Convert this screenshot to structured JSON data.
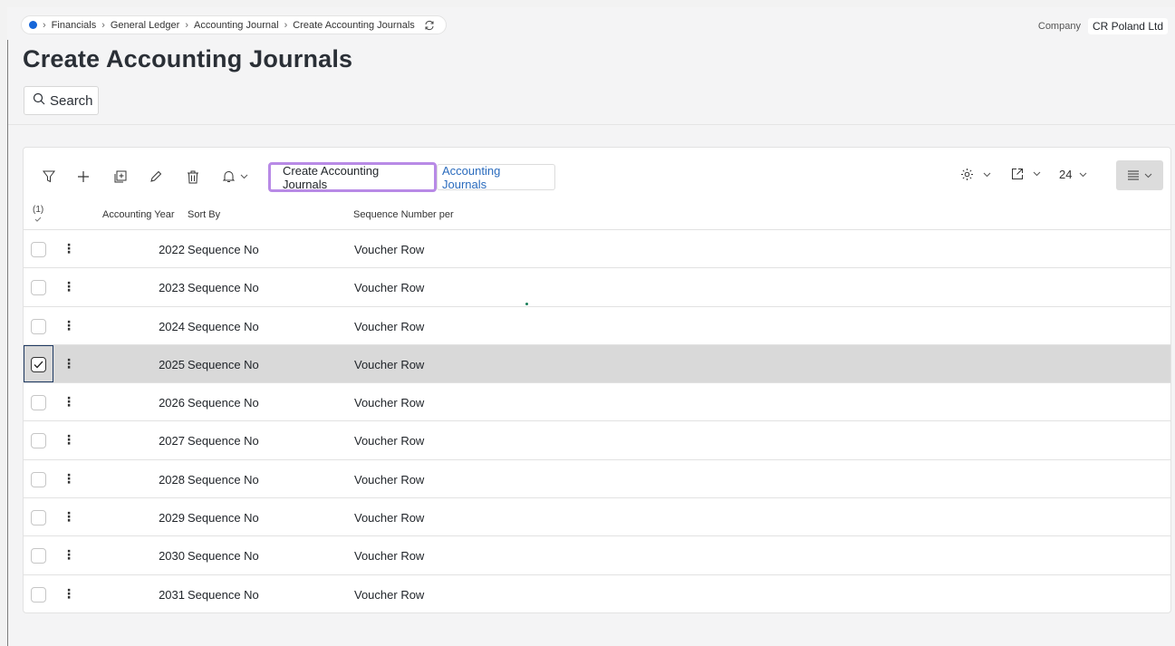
{
  "breadcrumb": {
    "items": [
      "Financials",
      "General Ledger",
      "Accounting Journal",
      "Create Accounting Journals"
    ]
  },
  "company": {
    "label": "Company",
    "value": "CR Poland Ltd"
  },
  "page": {
    "title": "Create Accounting Journals"
  },
  "search": {
    "label": "Search"
  },
  "toolbar": {
    "create_label": "Create Accounting Journals",
    "journals_label": "Accounting Journals",
    "page_size": "24",
    "icons": [
      "filter-icon",
      "add-icon",
      "duplicate-icon",
      "edit-icon",
      "delete-icon",
      "bell-icon",
      "settings-icon",
      "export-icon",
      "list-view-icon"
    ]
  },
  "grid": {
    "selected_count": "(1)",
    "columns": {
      "year": "Accounting Year",
      "sort": "Sort By",
      "seq": "Sequence Number per"
    },
    "rows": [
      {
        "year": "2022",
        "sort": "Sequence No",
        "seq": "Voucher Row",
        "selected": false
      },
      {
        "year": "2023",
        "sort": "Sequence No",
        "seq": "Voucher Row",
        "selected": false
      },
      {
        "year": "2024",
        "sort": "Sequence No",
        "seq": "Voucher Row",
        "selected": false
      },
      {
        "year": "2025",
        "sort": "Sequence No",
        "seq": "Voucher Row",
        "selected": true
      },
      {
        "year": "2026",
        "sort": "Sequence No",
        "seq": "Voucher Row",
        "selected": false
      },
      {
        "year": "2027",
        "sort": "Sequence No",
        "seq": "Voucher Row",
        "selected": false
      },
      {
        "year": "2028",
        "sort": "Sequence No",
        "seq": "Voucher Row",
        "selected": false
      },
      {
        "year": "2029",
        "sort": "Sequence No",
        "seq": "Voucher Row",
        "selected": false
      },
      {
        "year": "2030",
        "sort": "Sequence No",
        "seq": "Voucher Row",
        "selected": false
      },
      {
        "year": "2031",
        "sort": "Sequence No",
        "seq": "Voucher Row",
        "selected": false
      }
    ]
  },
  "colors": {
    "accent": "#1565d8",
    "highlight_border": "#b88ae6",
    "link": "#2a6bbd",
    "selected_row": "#d9d9d9"
  }
}
